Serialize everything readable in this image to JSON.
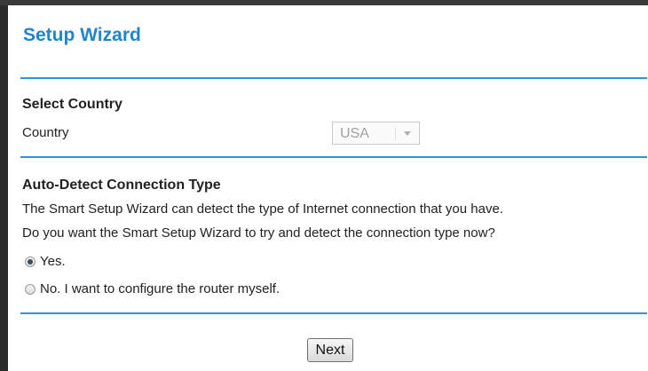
{
  "wizard": {
    "title": "Setup Wizard"
  },
  "country_section": {
    "heading": "Select Country",
    "country_label": "Country",
    "country_value": "USA"
  },
  "detect_section": {
    "heading": "Auto-Detect Connection Type",
    "line1": "The Smart Setup Wizard can detect the type of Internet connection that you have.",
    "line2": "Do you want the Smart Setup Wizard to try and detect the connection type now?",
    "options": [
      {
        "label": "Yes.",
        "selected": true
      },
      {
        "label": "No. I want to configure the router myself.",
        "selected": false
      }
    ]
  },
  "actions": {
    "next_label": "Next"
  },
  "colors": {
    "accent": "#1f86c9",
    "rule": "#2a95cf"
  }
}
